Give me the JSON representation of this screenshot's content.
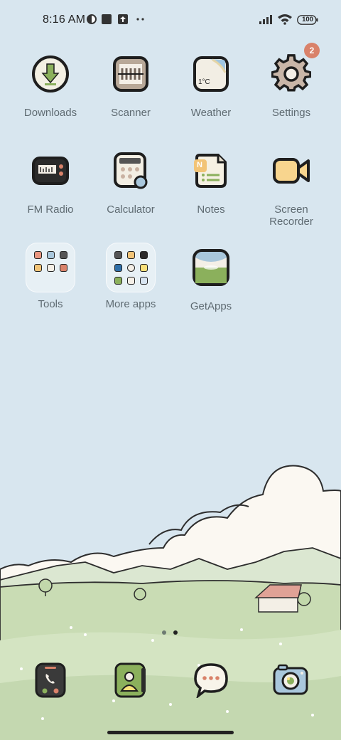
{
  "status_bar": {
    "time": "8:16 AM",
    "battery": "100",
    "notification_icons": [
      "contrast-icon",
      "square-icon",
      "upload-icon",
      "more-dots-icon"
    ],
    "system_icons": [
      "signal-icon",
      "wifi-icon",
      "battery-icon"
    ]
  },
  "apps": [
    {
      "label": "Downloads",
      "icon": "download-icon"
    },
    {
      "label": "Scanner",
      "icon": "scanner-icon"
    },
    {
      "label": "Weather",
      "icon": "weather-icon",
      "detail": "1°C"
    },
    {
      "label": "Settings",
      "icon": "gear-icon",
      "badge": "2"
    },
    {
      "label": "FM Radio",
      "icon": "radio-icon"
    },
    {
      "label": "Calculator",
      "icon": "calculator-icon"
    },
    {
      "label": "Notes",
      "icon": "notes-icon",
      "detail": "N"
    },
    {
      "label": "Screen\nRecorder",
      "icon": "video-camera-icon"
    },
    {
      "label": "GetApps",
      "icon": "store-icon"
    }
  ],
  "folders": [
    {
      "label": "Tools"
    },
    {
      "label": "More apps"
    }
  ],
  "dock": [
    {
      "name": "phone",
      "icon": "phone-icon"
    },
    {
      "name": "contacts",
      "icon": "contacts-icon"
    },
    {
      "name": "messages",
      "icon": "chat-bubble-icon"
    },
    {
      "name": "camera",
      "icon": "camera-icon"
    }
  ],
  "page_indicator": {
    "pages": 2,
    "current": 2
  },
  "colors": {
    "sky": "#d8e6ef",
    "grass": "#c9dcb4",
    "badge": "#d9826a",
    "label": "#5f6b72",
    "outline": "#222222"
  }
}
